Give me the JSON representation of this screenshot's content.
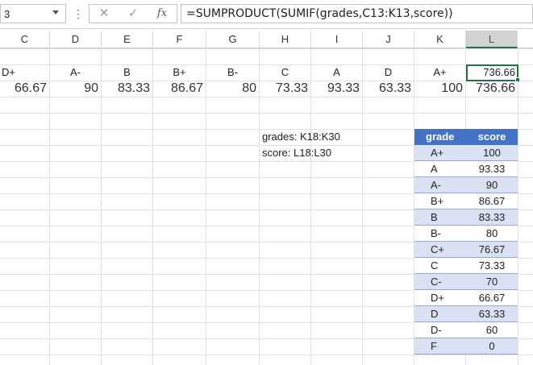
{
  "name_box": "3",
  "formula_bar": {
    "cancel_icon": "cross-icon",
    "enter_icon": "check-icon",
    "fx_label": "fx",
    "formula": "=SUMPRODUCT(SUMIF(grades,C13:K13,score))"
  },
  "columns": [
    "C",
    "D",
    "E",
    "F",
    "G",
    "H",
    "I",
    "J",
    "K",
    "L"
  ],
  "selected_column": "L",
  "grade_row": [
    "D+",
    "A-",
    "B",
    "B+",
    "B-",
    "C",
    "A",
    "D",
    "A+",
    "736.66"
  ],
  "score_row": [
    "66.67",
    "90",
    "83.33",
    "86.67",
    "80",
    "73.33",
    "93.33",
    "63.33",
    "100",
    "736.66"
  ],
  "notes": {
    "grades_range": "grades: K18:K30",
    "score_range": "score: L18:L30"
  },
  "lookup_table": {
    "headers": [
      "grade",
      "score"
    ],
    "rows": [
      [
        "A+",
        "100"
      ],
      [
        "A",
        "93.33"
      ],
      [
        "A-",
        "90"
      ],
      [
        "B+",
        "86.67"
      ],
      [
        "B",
        "83.33"
      ],
      [
        "B-",
        "80"
      ],
      [
        "C+",
        "76.67"
      ],
      [
        "C",
        "73.33"
      ],
      [
        "C-",
        "70"
      ],
      [
        "D+",
        "66.67"
      ],
      [
        "D",
        "63.33"
      ],
      [
        "D-",
        "60"
      ],
      [
        "F",
        "0"
      ]
    ]
  },
  "colors": {
    "table_header": "#4472c4",
    "table_band": "#d9e1f2",
    "selection": "#217346"
  }
}
